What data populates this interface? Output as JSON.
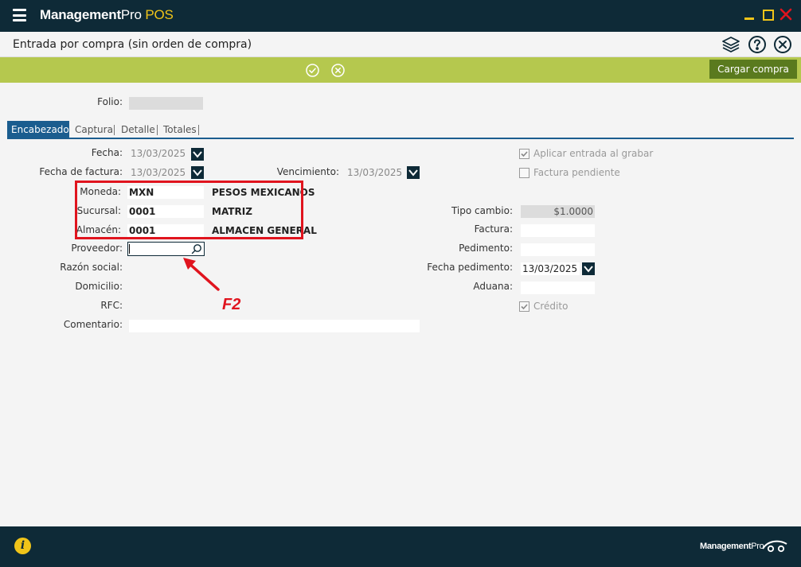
{
  "app": {
    "brand_bold": "Management",
    "brand_regular": "Pro",
    "brand_accent": "POS",
    "accent_color": "#f0c419",
    "header_bg": "#0e2a37"
  },
  "window": {
    "min_icon": "minimize-icon",
    "max_icon": "maximize-icon",
    "close_icon": "close-window-icon"
  },
  "page": {
    "title": "Entrada por compra (sin orden de compra)"
  },
  "toolbar": {
    "layers_icon": "layers-icon",
    "help_icon": "help-icon",
    "close_icon": "close-circle-icon"
  },
  "actions": {
    "accept_icon": "check-circle-icon",
    "cancel_icon": "x-circle-icon",
    "cargar_label": "Cargar compra",
    "bar_color": "#b5c84e"
  },
  "folio": {
    "label": "Folio:",
    "value": ""
  },
  "tabs": [
    {
      "label": "Encabezado",
      "active": true
    },
    {
      "label": "Captura",
      "active": false
    },
    {
      "label": "Detalle",
      "active": false
    },
    {
      "label": "Totales",
      "active": false
    }
  ],
  "form": {
    "fecha": {
      "label": "Fecha:",
      "value": "13/03/2025"
    },
    "fecha_factura": {
      "label": "Fecha de factura:",
      "value": "13/03/2025"
    },
    "vencimiento": {
      "label": "Vencimiento:",
      "value": "13/03/2025"
    },
    "moneda": {
      "label": "Moneda:",
      "code": "MXN",
      "name": "PESOS MEXICANOS"
    },
    "sucursal": {
      "label": "Sucursal:",
      "code": "0001",
      "name": "MATRIZ"
    },
    "almacen": {
      "label": "Almacén:",
      "code": "0001",
      "name": "ALMACEN GENERAL"
    },
    "proveedor": {
      "label": "Proveedor:",
      "value": "",
      "search_icon": "search-icon"
    },
    "razon_social": {
      "label": "Razón social:",
      "value": ""
    },
    "domicilio": {
      "label": "Domicilio:",
      "value": ""
    },
    "rfc": {
      "label": "RFC:",
      "value": ""
    },
    "comentario": {
      "label": "Comentario:",
      "value": ""
    },
    "aplicar_entrada": {
      "label": "Aplicar entrada al grabar",
      "checked": true
    },
    "factura_pendiente": {
      "label": "Factura pendiente",
      "checked": false
    },
    "tipo_cambio": {
      "label": "Tipo cambio:",
      "value": "$1.0000"
    },
    "factura": {
      "label": "Factura:",
      "value": ""
    },
    "pedimento": {
      "label": "Pedimento:",
      "value": ""
    },
    "fecha_pedimento": {
      "label": "Fecha pedimento:",
      "value": "13/03/2025"
    },
    "aduana": {
      "label": "Aduana:",
      "value": ""
    },
    "credito": {
      "label": "Crédito",
      "checked": true
    }
  },
  "annotation": {
    "text": "F2",
    "color": "#e0141e"
  },
  "footer": {
    "info_icon": "info-icon",
    "brand_bold": "Management",
    "brand_regular": "Pro"
  }
}
